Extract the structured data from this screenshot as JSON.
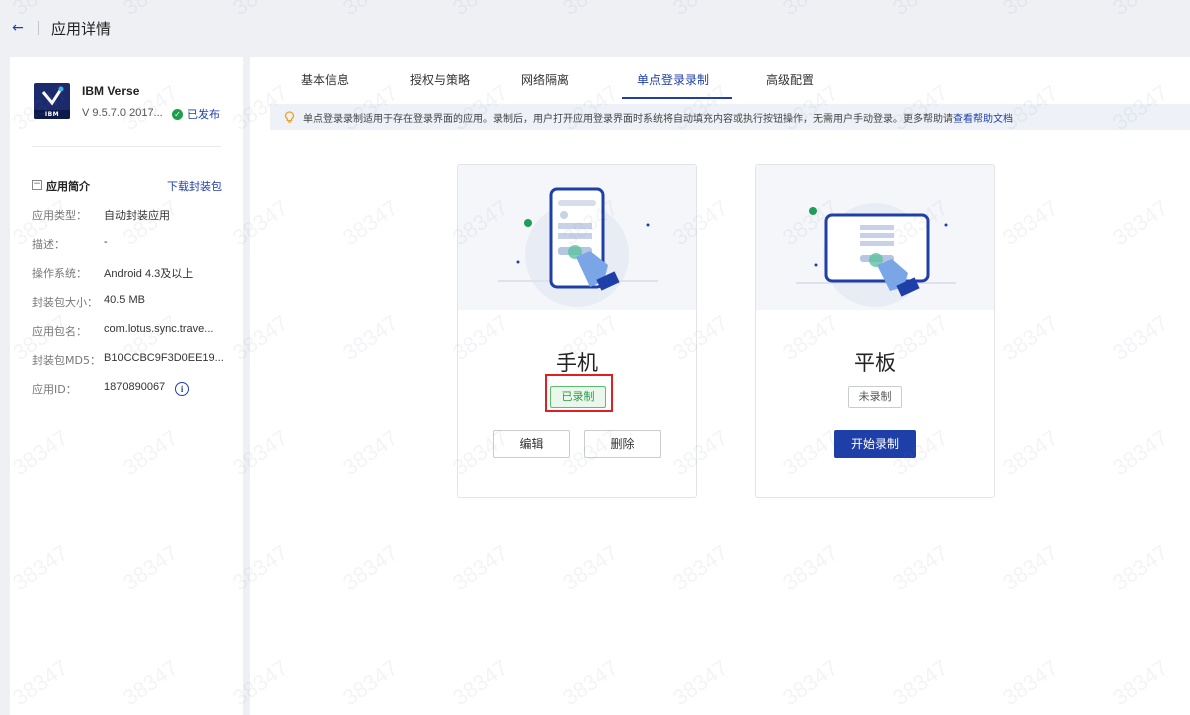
{
  "header": {
    "title": "应用详情"
  },
  "app": {
    "name": "IBM Verse",
    "logo_text": "IBM",
    "version": "V 9.5.7.0 2017...",
    "status": "已发布"
  },
  "intro": {
    "title": "应用简介",
    "download_label": "下载封装包",
    "rows": [
      {
        "label": "应用类型：",
        "value": "自动封装应用"
      },
      {
        "label": "描述：",
        "value": "-"
      },
      {
        "label": "操作系统：",
        "value": "Android 4.3及以上"
      },
      {
        "label": "封装包大小：",
        "value": "40.5 MB"
      },
      {
        "label": "应用包名：",
        "value": "com.lotus.sync.trave..."
      },
      {
        "label": "封装包MD5：",
        "value": "B10CCBC9F3D0EE19..."
      },
      {
        "label": "应用ID：",
        "value": "1870890067"
      }
    ]
  },
  "tabs": [
    {
      "label": "基本信息"
    },
    {
      "label": "授权与策略"
    },
    {
      "label": "网络隔离"
    },
    {
      "label": "单点登录录制"
    },
    {
      "label": "高级配置"
    }
  ],
  "notice": {
    "text": "单点登录录制适用于存在登录界面的应用。录制后，用户打开应用登录界面时系统将自动填充内容或执行按钮操作，无需用户手动登录。更多帮助请",
    "link": "查看帮助文档"
  },
  "cards": {
    "phone": {
      "title": "手机",
      "status": "已录制",
      "edit_label": "编辑",
      "delete_label": "删除"
    },
    "tablet": {
      "title": "平板",
      "status": "未录制",
      "start_label": "开始录制"
    }
  },
  "watermark": "38347",
  "colors": {
    "primary": "#1f3fa8",
    "success": "#2a9a44",
    "highlight": "#e02020"
  }
}
